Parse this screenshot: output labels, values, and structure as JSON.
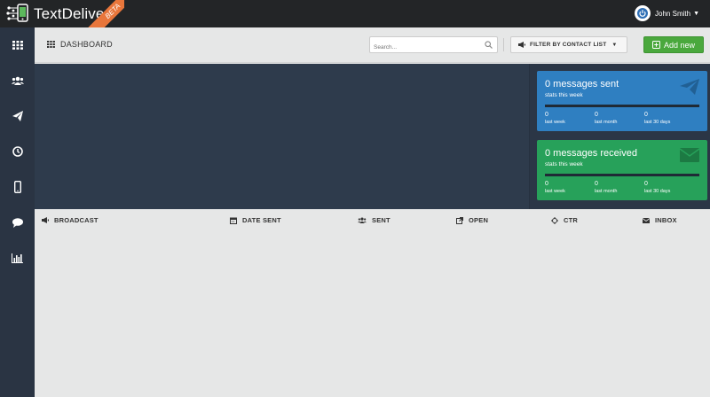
{
  "app": {
    "name": "TextDeliver",
    "badge": "BETA",
    "user_name": "John Smith"
  },
  "sidebar": {
    "items": [
      {
        "icon": "grid-icon"
      },
      {
        "icon": "users-icon"
      },
      {
        "icon": "paper-plane-icon"
      },
      {
        "icon": "clock-icon"
      },
      {
        "icon": "mobile-icon"
      },
      {
        "icon": "chat-bubble-icon"
      },
      {
        "icon": "bar-chart-icon"
      }
    ]
  },
  "toolbar": {
    "title": "DASHBOARD",
    "search_placeholder": "Search...",
    "filter_label": "FILTER BY CONTACT LIST",
    "add_label": "Add new"
  },
  "stats": {
    "sent": {
      "title": "0 messages sent",
      "subtitle": "stats this week",
      "color": "#2f7fc1",
      "cols": [
        {
          "value": "0",
          "label": "last week"
        },
        {
          "value": "0",
          "label": "last month"
        },
        {
          "value": "0",
          "label": "last 30 days"
        }
      ]
    },
    "received": {
      "title": "0 messages received",
      "subtitle": "stats this week",
      "color": "#27a15a",
      "cols": [
        {
          "value": "0",
          "label": "last week"
        },
        {
          "value": "0",
          "label": "last month"
        },
        {
          "value": "0",
          "label": "last 30 days"
        }
      ]
    }
  },
  "table": {
    "columns": [
      "BROADCAST",
      "DATE SENT",
      "SENT",
      "OPEN",
      "CTR",
      "INBOX"
    ]
  },
  "colors": {
    "accent_orange": "#e8763b",
    "add_green": "#4aa83d",
    "sidebar_bg": "#2a3443",
    "hero_bg": "#2e3b4c"
  }
}
